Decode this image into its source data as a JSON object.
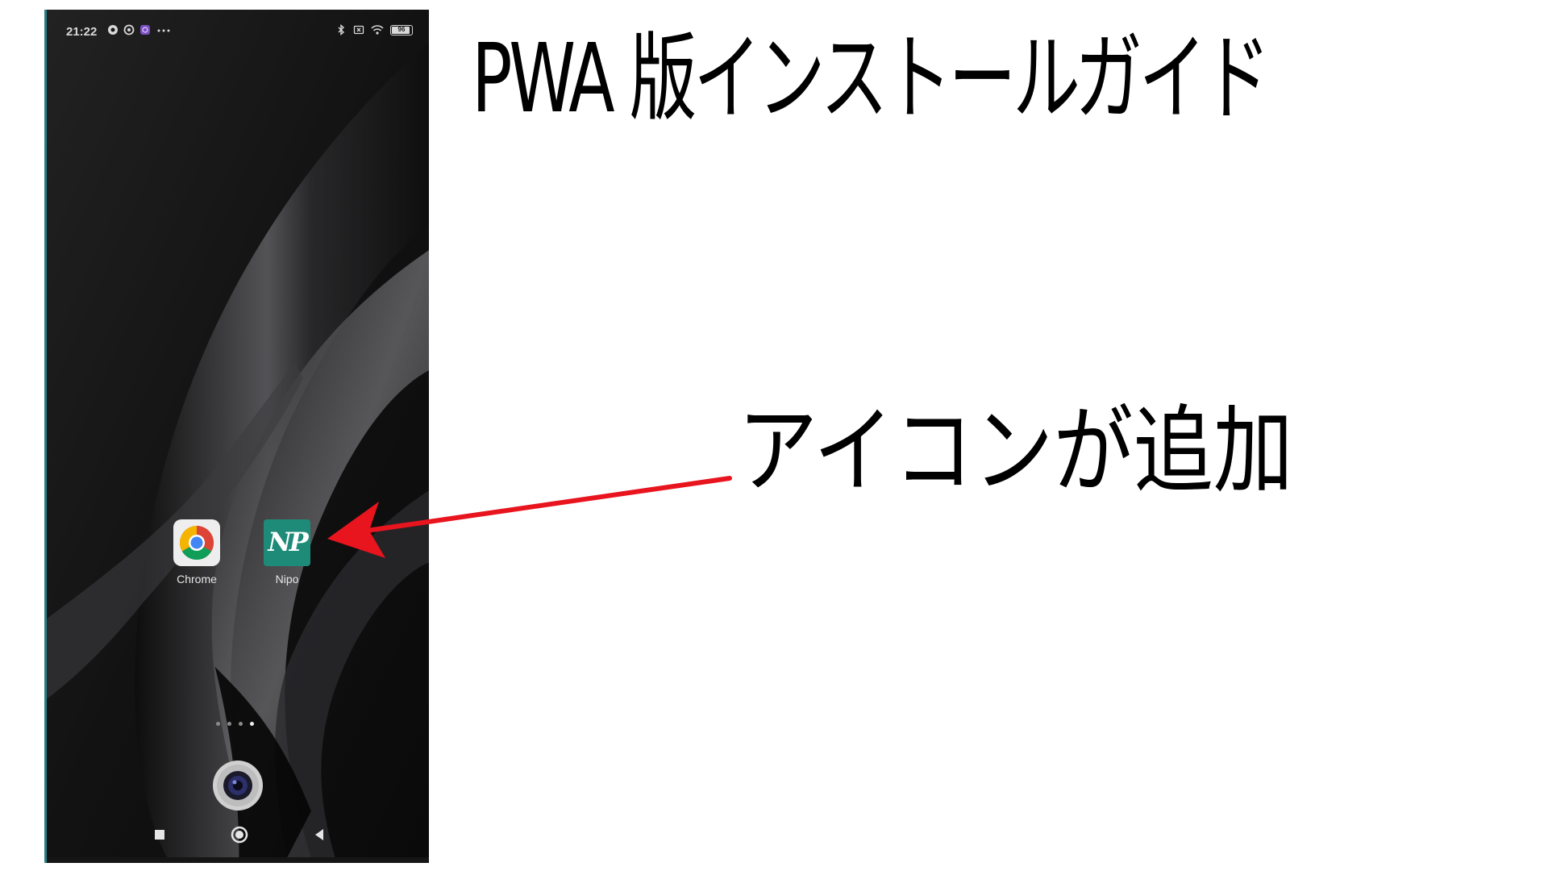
{
  "guide": {
    "title": "PWA 版インストールガイド",
    "annotation": "アイコンが追加"
  },
  "phone": {
    "status_bar": {
      "time": "21:22",
      "left_icons": [
        "chrome-status-icon",
        "vpn-status-icon",
        "app-status-icon",
        "more-dots-icon"
      ],
      "right_icons": [
        "bluetooth-icon",
        "sim-off-icon",
        "wifi-icon",
        "battery-icon"
      ],
      "battery_level": "96"
    },
    "home_apps": [
      {
        "label": "Chrome",
        "icon": "chrome-icon"
      },
      {
        "label": "Nipo",
        "icon": "nipo-np-icon",
        "monogram": "NP"
      }
    ],
    "page_indicator": {
      "count": 4,
      "active": 4
    },
    "dock": [
      {
        "icon": "camera-icon"
      }
    ],
    "nav_buttons": [
      "recents-square-icon",
      "home-circle-icon",
      "back-triangle-icon"
    ]
  },
  "colors": {
    "arrow": "#e8141e",
    "nipo_tile": "#1e8a78",
    "wallpaper": "#151515"
  }
}
